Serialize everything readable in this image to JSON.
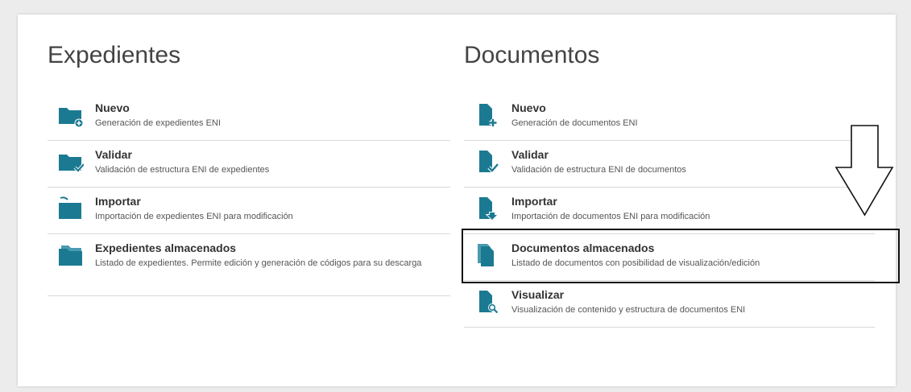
{
  "colors": {
    "icon": "#1b7a92",
    "title": "#444444",
    "divider": "#d9d9d9"
  },
  "expedientes": {
    "title": "Expedientes",
    "items": [
      {
        "title": "Nuevo",
        "desc": "Generación de expedientes ENI",
        "icon": "folder-plus-icon"
      },
      {
        "title": "Validar",
        "desc": "Validación de estructura ENI de expedientes",
        "icon": "folder-check-icon"
      },
      {
        "title": "Importar",
        "desc": "Importación de expedientes ENI para modificación",
        "icon": "folder-open-icon"
      },
      {
        "title": "Expedientes almacenados",
        "desc": "Listado de expedientes. Permite edición y generación de códigos para su descarga",
        "icon": "folders-icon"
      }
    ]
  },
  "documentos": {
    "title": "Documentos",
    "items": [
      {
        "title": "Nuevo",
        "desc": "Generación de documentos ENI",
        "icon": "document-plus-icon"
      },
      {
        "title": "Validar",
        "desc": "Validación de estructura ENI de documentos",
        "icon": "document-check-icon"
      },
      {
        "title": "Importar",
        "desc": "Importación de documentos ENI para modificación",
        "icon": "document-import-icon"
      },
      {
        "title": "Documentos almacenados",
        "desc": "Listado de documentos con posibilidad de visualización/edición",
        "icon": "documents-icon"
      },
      {
        "title": "Visualizar",
        "desc": "Visualización de contenido y estructura de documentos ENI",
        "icon": "document-search-icon"
      }
    ]
  }
}
